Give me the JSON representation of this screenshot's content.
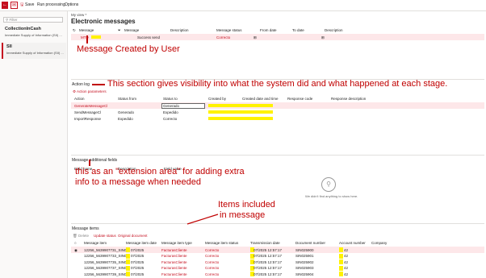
{
  "toolbar": {
    "save_label": "Save",
    "run_label": "Run processing",
    "options_label": "Options"
  },
  "sidebar": {
    "filter_placeholder": "Filter",
    "items": [
      {
        "title": "CollectionInCash",
        "subtitle": "Immediate Supply of Information (SII) ..."
      },
      {
        "title": "SII",
        "subtitle": "Immediate Supply of Information (SII) ..."
      }
    ]
  },
  "header": {
    "view_label": "My view *",
    "title": "Electronic messages"
  },
  "messages": {
    "columns": [
      "Message",
      "Message",
      "Description",
      "Message status",
      "From date",
      "To date",
      "Description"
    ],
    "row": {
      "message": "MTD",
      "status_text": "Success send",
      "message_status": "Correcto"
    }
  },
  "action_log": {
    "title": "Action log",
    "action_params": "Action parameters",
    "columns": [
      "Action",
      "Status from",
      "Status to",
      "Created by",
      "Created date and time",
      "Response code",
      "Response description"
    ],
    "rows": [
      {
        "action": "GenerateMessageCl",
        "from": "",
        "to": "Generado"
      },
      {
        "action": "SendMessageCl",
        "from": "Generado",
        "to": "Expedido"
      },
      {
        "action": "ImportResponse",
        "from": "Expedido",
        "to": "Correcto"
      }
    ]
  },
  "additional_fields": {
    "title": "Message additional fields",
    "columns": [
      "Field name",
      "Description",
      "Field value"
    ],
    "empty_text": "We didn't find anything to show here."
  },
  "items": {
    "title": "Message items",
    "actions": [
      "Delete",
      "Update status",
      "Original document"
    ],
    "columns": [
      "Message item",
      "Message item date",
      "Message item type",
      "Message item status",
      "Transmission date",
      "Document number",
      "Account number",
      "Company"
    ],
    "rows": [
      {
        "item": "12256_5639907731_SIN0...",
        "date": "07/2025",
        "type": "FacturasCliente",
        "status": "Correcto",
        "tx": "07/2025 12:57:17",
        "doc": "SIN025900",
        "acct": "42"
      },
      {
        "item": "12256_5639907733_SIN0...",
        "date": "07/2025",
        "type": "FacturasCliente",
        "status": "Correcto",
        "tx": "07/2025 12:57:17",
        "doc": "SIN025901",
        "acct": "42"
      },
      {
        "item": "12256_5639907735_SIN0...",
        "date": "07/2025",
        "type": "FacturasCliente",
        "status": "Correcto",
        "tx": "07/2025 12:57:17",
        "doc": "SIN025902",
        "acct": "42"
      },
      {
        "item": "12256_5639907737_SIN0...",
        "date": "07/2025",
        "type": "FacturasCliente",
        "status": "Correcto",
        "tx": "07/2025 12:57:17",
        "doc": "SIN025903",
        "acct": "42"
      },
      {
        "item": "12256_5639907739_SIN0...",
        "date": "07/2025",
        "type": "FacturasCliente",
        "status": "Correcto",
        "tx": "07/2025 12:57:17",
        "doc": "SIN025904",
        "acct": "42"
      }
    ]
  },
  "annotations": {
    "created": "Message Created by User",
    "action_log": "This section gives visibility into what the system did and what happened at each stage.",
    "extension_line1": "this as an \"extension area\" for adding extra",
    "extension_line2": "info to a message when needed",
    "items_line1": "Items included",
    "items_line2": "in message"
  },
  "colors": {
    "accent": "#c50f1f",
    "annotation": "#c00000",
    "highlight": "#fff200"
  }
}
